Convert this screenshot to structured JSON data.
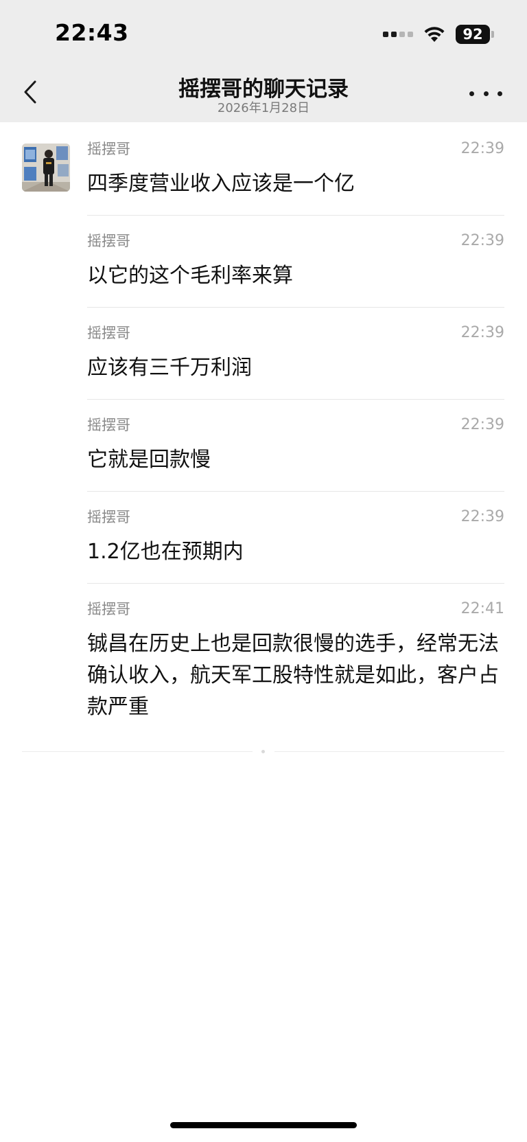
{
  "status_bar": {
    "time": "22:43",
    "battery": "92"
  },
  "nav": {
    "title": "摇摆哥的聊天记录",
    "subtitle": "2026年1月28日"
  },
  "messages": [
    {
      "sender": "摇摆哥",
      "time": "22:39",
      "text": "四季度营业收入应该是一个亿"
    },
    {
      "sender": "摇摆哥",
      "time": "22:39",
      "text": "以它的这个毛利率来算"
    },
    {
      "sender": "摇摆哥",
      "time": "22:39",
      "text": "应该有三千万利润"
    },
    {
      "sender": "摇摆哥",
      "time": "22:39",
      "text": "它就是回款慢"
    },
    {
      "sender": "摇摆哥",
      "time": "22:39",
      "text": "1.2亿也在预期内"
    },
    {
      "sender": "摇摆哥",
      "time": "22:41",
      "text": "铖昌在历史上也是回款很慢的选手，经常无法确认收入，航天军工股特性就是如此，客户占款严重"
    }
  ],
  "colors": {
    "header_bg": "#ededed",
    "meta_text": "#8a8a8a",
    "divider": "#e6e6e6"
  },
  "icons": [
    "back-chevron-icon",
    "more-dots-icon",
    "wifi-icon",
    "signal-icon",
    "battery-icon"
  ]
}
